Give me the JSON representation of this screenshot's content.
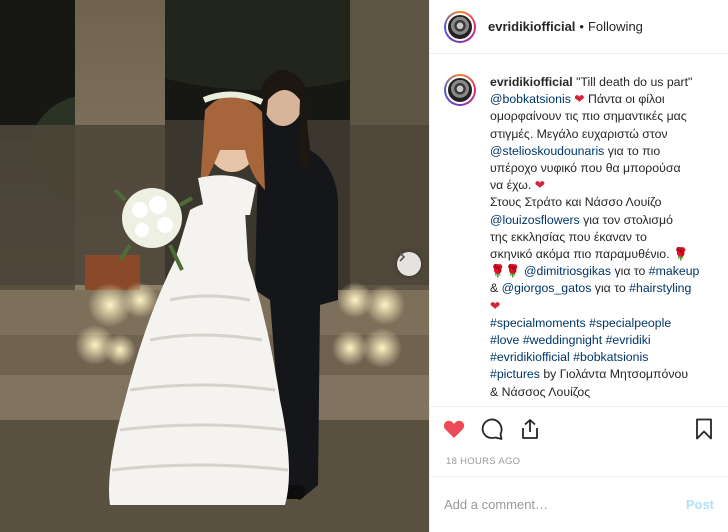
{
  "header": {
    "username": "evridikiofficial",
    "separator": "•",
    "follow_status": "Following"
  },
  "caption": {
    "username": "evridikiofficial",
    "lines": [
      "\"Till death do us part\"",
      "Πάντα οι φίλοι",
      "ομορφαίνουν τις πιο σημαντικές μας",
      "στιγμές. Μεγάλο ευχαριστώ στον",
      "για το πιο",
      "υπέροχο νυφικό που θα μπορούσα",
      "να έχω.",
      "Στους Στράτο και Νάσσο Λουίζο",
      "για τον στολισμό",
      "της εκκλησίας που έκαναν το",
      "σκηνικό ακόμα πιο παραμυθένιο.",
      "για το",
      "&",
      "για το",
      "by Γιολάντα Μητσομπόνου",
      "& Νάσσος Λουίζος"
    ],
    "mentions": {
      "bobkatsionis": "@bobkatsionis",
      "stelioskoudounaris": "@stelioskoudounaris",
      "louizosflowers": "@louizosflowers",
      "dimitriosgikas": "@dimitriosgikas",
      "giorgos_gatos": "@giorgos_gatos"
    },
    "hashtags": {
      "makeup": "#makeup",
      "hairstyling": "#hairstyling",
      "specialmoments": "#specialmoments",
      "specialpeople": "#specialpeople",
      "love": "#love",
      "weddingnight": "#weddingnight",
      "evridiki": "#evridiki",
      "evridikiofficial": "#evridikiofficial",
      "bobkatsionis": "#bobkatsionis",
      "pictures": "#pictures"
    }
  },
  "timestamp": "18 HOURS AGO",
  "comment_box": {
    "placeholder": "Add a comment…",
    "post_label": "Post"
  },
  "colors": {
    "like": "#ed4956",
    "link": "#003569",
    "post_disabled": "#b2dffc"
  },
  "icons": [
    "heart-icon",
    "comment-icon",
    "share-icon",
    "bookmark-icon",
    "chevron-right-icon"
  ]
}
